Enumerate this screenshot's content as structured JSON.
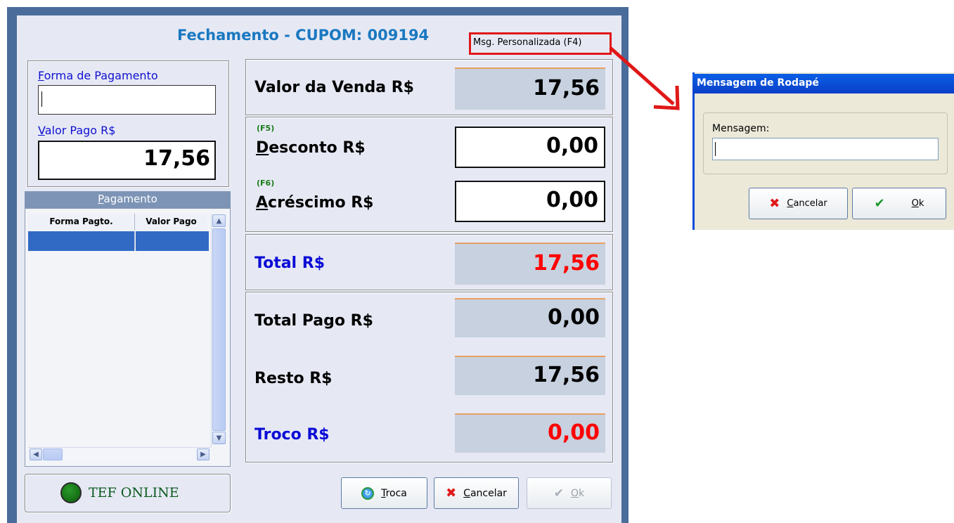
{
  "window": {
    "title": "Fechamento - CUPOM: 009194",
    "msg_button": "Msg. Personalizada (F4)"
  },
  "payment_form": {
    "forma_label_first": "F",
    "forma_label_rest": "orma de Pagamento",
    "forma_value": "",
    "valor_label_first": "V",
    "valor_label_rest": "alor Pago R$",
    "valor_value": "17,56"
  },
  "payments_grid": {
    "title_first": "P",
    "title_rest": "agamento",
    "columns": [
      "Forma Pagto.",
      "Valor Pago"
    ],
    "rows": [
      [
        "",
        ""
      ]
    ]
  },
  "totals": {
    "valor_venda_label": "Valor da Venda R$",
    "valor_venda": "17,56",
    "desconto_key": "(F5)",
    "desconto_label_first": "D",
    "desconto_label_rest": "esconto R$",
    "desconto": "0,00",
    "acrescimo_key": "(F6)",
    "acrescimo_label_first": "A",
    "acrescimo_label_rest": "créscimo R$",
    "acrescimo": "0,00",
    "total_label": "Total R$",
    "total": "17,56",
    "total_pago_label": "Total Pago R$",
    "total_pago": "0,00",
    "resto_label": "Resto R$",
    "resto": "17,56",
    "troco_label": "Troco R$",
    "troco": "0,00"
  },
  "status": {
    "tef_text": "TEF ONLINE"
  },
  "buttons": {
    "troca_first": "T",
    "troca_rest": "roca",
    "cancelar_first": "C",
    "cancelar_rest": "ancelar",
    "ok_first": "O",
    "ok_rest": "k"
  },
  "dialog": {
    "title": "Mensagem de Rodapé",
    "field_label": "Mensagem:",
    "field_value": "",
    "cancel_first": "C",
    "cancel_rest": "ancelar",
    "ok_first": "O",
    "ok_rest": "k"
  },
  "colors": {
    "accent_title": "#1a78c0",
    "total_value": "#ff0000",
    "label_blue": "#0b0bd6",
    "highlight_red": "#e01818",
    "tef_green": "#0b7a1e"
  },
  "icons": [
    "refresh-icon",
    "x-cancel-icon",
    "check-icon",
    "status-led-icon",
    "arrow-icon"
  ]
}
